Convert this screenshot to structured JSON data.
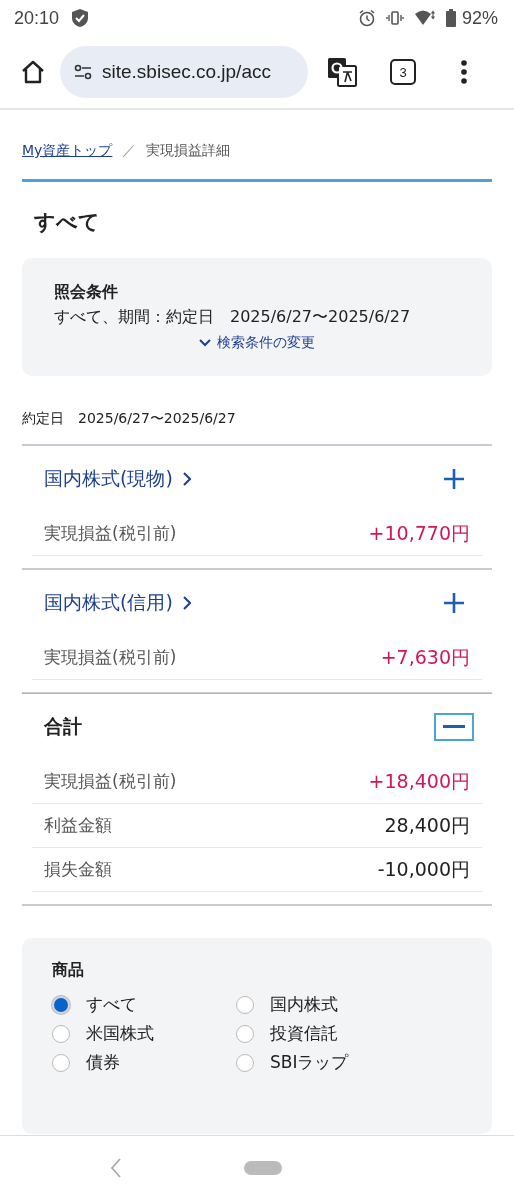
{
  "status_bar": {
    "time": "20:10",
    "battery": "92%"
  },
  "browser": {
    "url": "site.sbisec.co.jp/acc",
    "tab_count": "3"
  },
  "breadcrumb": [
    {
      "label": "My資産トップ",
      "kind": "link"
    },
    {
      "label": "／",
      "kind": "separator"
    },
    {
      "label": "実現損益詳細",
      "kind": "current"
    }
  ],
  "heading": "すべて",
  "query_card": {
    "title": "照会条件",
    "conditions": "すべて、期間：約定日　2025/6/27〜2025/6/27",
    "change_link": "検索条件の変更"
  },
  "period": "約定日　2025/6/27〜2025/6/27",
  "sections": [
    {
      "title": "国内株式(現物)",
      "kind": "link",
      "expanded": false,
      "rows": [
        {
          "label": "実現損益(税引前)",
          "value": "+10,770円",
          "color": "#d0175c"
        }
      ]
    },
    {
      "title": "国内株式(信用)",
      "kind": "link",
      "expanded": false,
      "rows": [
        {
          "label": "実現損益(税引前)",
          "value": "+7,630円",
          "color": "#d0175c"
        }
      ]
    },
    {
      "title": "合計",
      "kind": "total",
      "expanded": true,
      "rows": [
        {
          "label": "実現損益(税引前)",
          "value": "+18,400円",
          "color": "#d0175c"
        },
        {
          "label": "利益金額",
          "value": "28,400円",
          "color": "#222222"
        },
        {
          "label": "損失金額",
          "value": "-10,000円",
          "color": "#222222"
        }
      ]
    }
  ],
  "product_filter": {
    "title": "商品",
    "options": [
      {
        "label": "すべて",
        "selected": true
      },
      {
        "label": "国内株式",
        "selected": false
      },
      {
        "label": "米国株式",
        "selected": false
      },
      {
        "label": "投資信託",
        "selected": false
      },
      {
        "label": "債券",
        "selected": false
      },
      {
        "label": "SBIラップ",
        "selected": false
      }
    ]
  }
}
